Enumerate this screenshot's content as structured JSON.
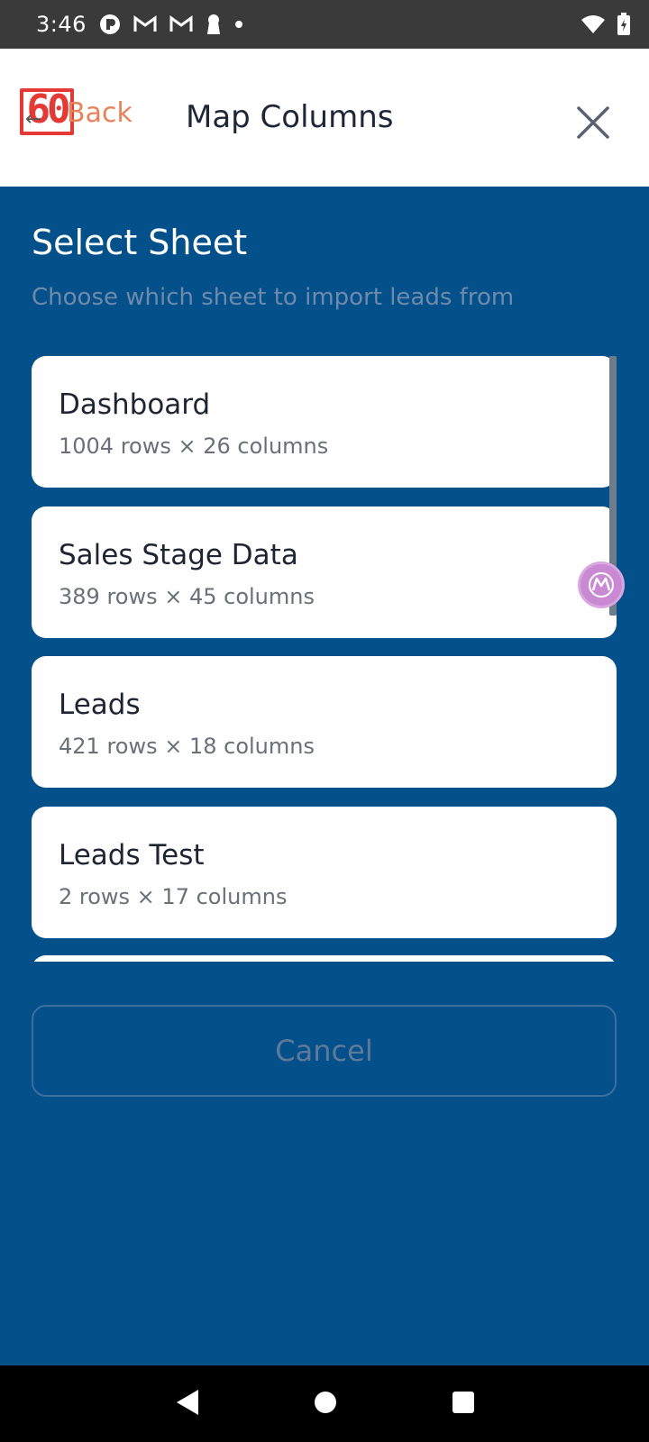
{
  "status_bar": {
    "time": "3:46",
    "icons": [
      "app-icon",
      "gmail-icon",
      "gmail-icon",
      "keyhole-icon",
      "dot-icon"
    ],
    "right_icons": [
      "wifi-icon",
      "battery-icon"
    ]
  },
  "header": {
    "back_label": "Back",
    "badge_text": "60",
    "title": "Map Columns",
    "close_icon": "close-icon"
  },
  "main": {
    "title": "Select Sheet",
    "subtitle": "Choose which sheet to import leads from",
    "sheets": [
      {
        "name": "Dashboard",
        "meta": "1004 rows × 26 columns"
      },
      {
        "name": "Sales Stage Data",
        "meta": "389 rows × 45 columns"
      },
      {
        "name": "Leads",
        "meta": "421 rows × 18 columns"
      },
      {
        "name": "Leads Test",
        "meta": "2 rows × 17 columns"
      },
      {
        "name": "",
        "meta": ""
      }
    ],
    "cancel_label": "Cancel"
  },
  "colors": {
    "background": "#04508a",
    "accent": "#e8825a",
    "card": "#fefefe"
  },
  "nav_bar": [
    "back-icon",
    "home-icon",
    "recents-icon"
  ]
}
